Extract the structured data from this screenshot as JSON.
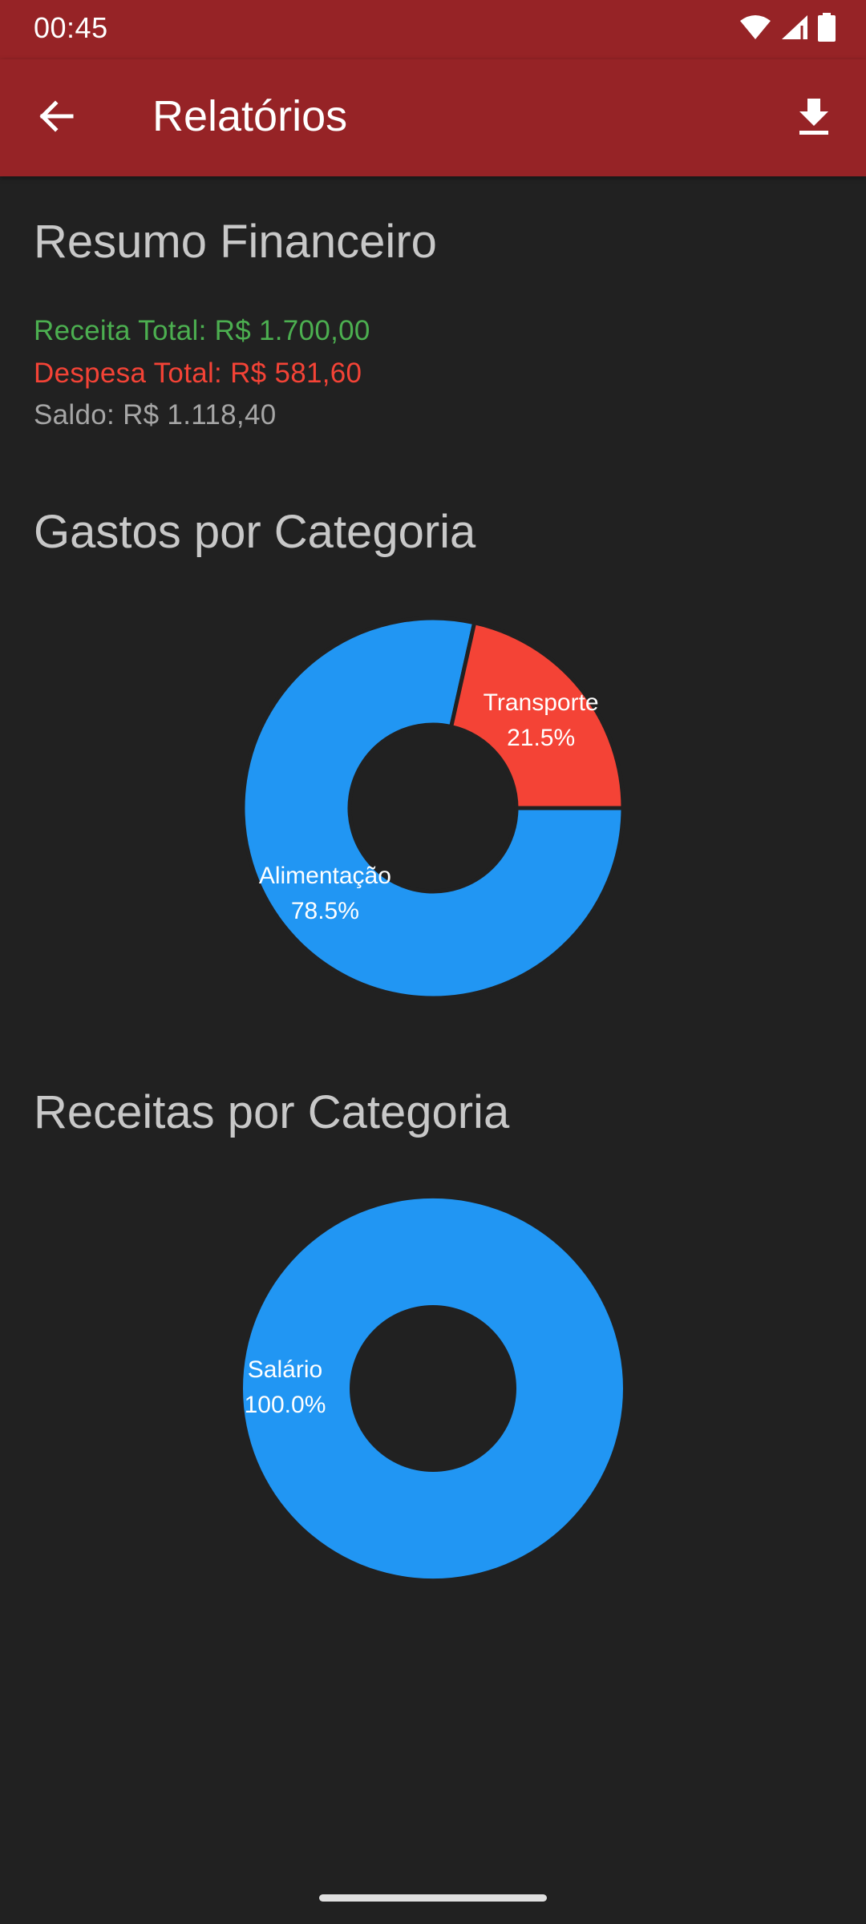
{
  "status_bar": {
    "time": "00:45",
    "icons": [
      "wifi-icon",
      "signal-icon",
      "battery-icon"
    ]
  },
  "app_bar": {
    "back_icon": "arrow-back-icon",
    "title": "Relatórios",
    "download_icon": "download-icon",
    "color": "#962326"
  },
  "summary": {
    "title": "Resumo Financeiro",
    "income": "Receita Total: R$ 1.700,00",
    "expense": "Despesa Total: R$ 581,60",
    "balance": "Saldo: R$ 1.118,40",
    "colors": {
      "income": "#4caf50",
      "expense": "#f44336",
      "balance": "#a6a6a6"
    }
  },
  "expenses_chart": {
    "title": "Gastos por Categoria"
  },
  "income_chart": {
    "title": "Receitas por Categoria"
  },
  "chart_data": [
    {
      "type": "pie",
      "donut": true,
      "categories": [
        "Alimentação",
        "Transporte"
      ],
      "values": [
        78.5,
        21.5
      ],
      "value_labels": [
        "78.5%",
        "21.5%"
      ],
      "colors": [
        "#2196f3",
        "#f44336"
      ]
    },
    {
      "type": "pie",
      "donut": true,
      "categories": [
        "Salário"
      ],
      "values": [
        100.0
      ],
      "value_labels": [
        "100.0%"
      ],
      "colors": [
        "#2196f3"
      ]
    }
  ]
}
